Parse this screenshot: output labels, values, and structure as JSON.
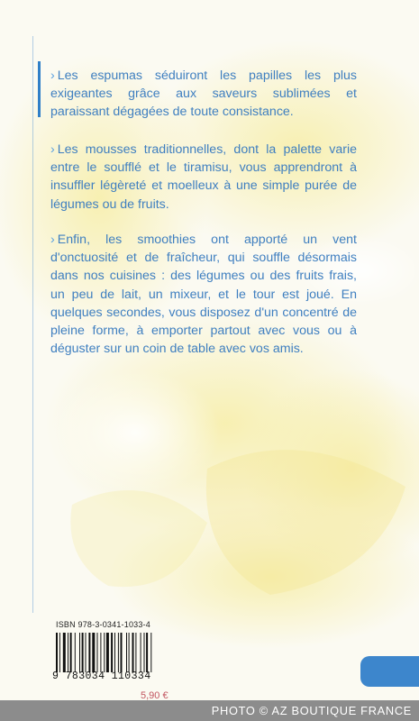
{
  "paragraphs": [
    {
      "marker": "›",
      "text": "Les espumas séduiront les papilles les plus exigeantes grâce aux saveurs sublimées et paraissant dégagées de toute consistance."
    },
    {
      "marker": "›",
      "text": "Les mousses traditionnelles, dont la palette varie entre le soufflé et le tiramisu, vous apprendront à insuffler légèreté et moelleux à une simple purée de légumes ou de fruits."
    },
    {
      "marker": "›",
      "text": "Enfin, les smoothies ont apporté un vent d'onctuosité et de fraîcheur, qui souffle désormais dans nos cuisines : des légumes ou des fruits frais, un peu de lait, un mixeur, et le tour est joué. En quelques secondes, vous disposez d'un concentré de pleine forme, à emporter partout avec vous ou à déguster sur un coin de table avec vos amis."
    }
  ],
  "barcode": {
    "isbn_label": "ISBN  978-3-0341-1033-4",
    "digits": "9 783034 110334"
  },
  "price": "5,90 €",
  "watermark": "PHOTO © AZ BOUTIQUE FRANCE",
  "colors": {
    "text": "#3f7fc0",
    "accent": "#3d86cc",
    "price": "#c25560"
  }
}
